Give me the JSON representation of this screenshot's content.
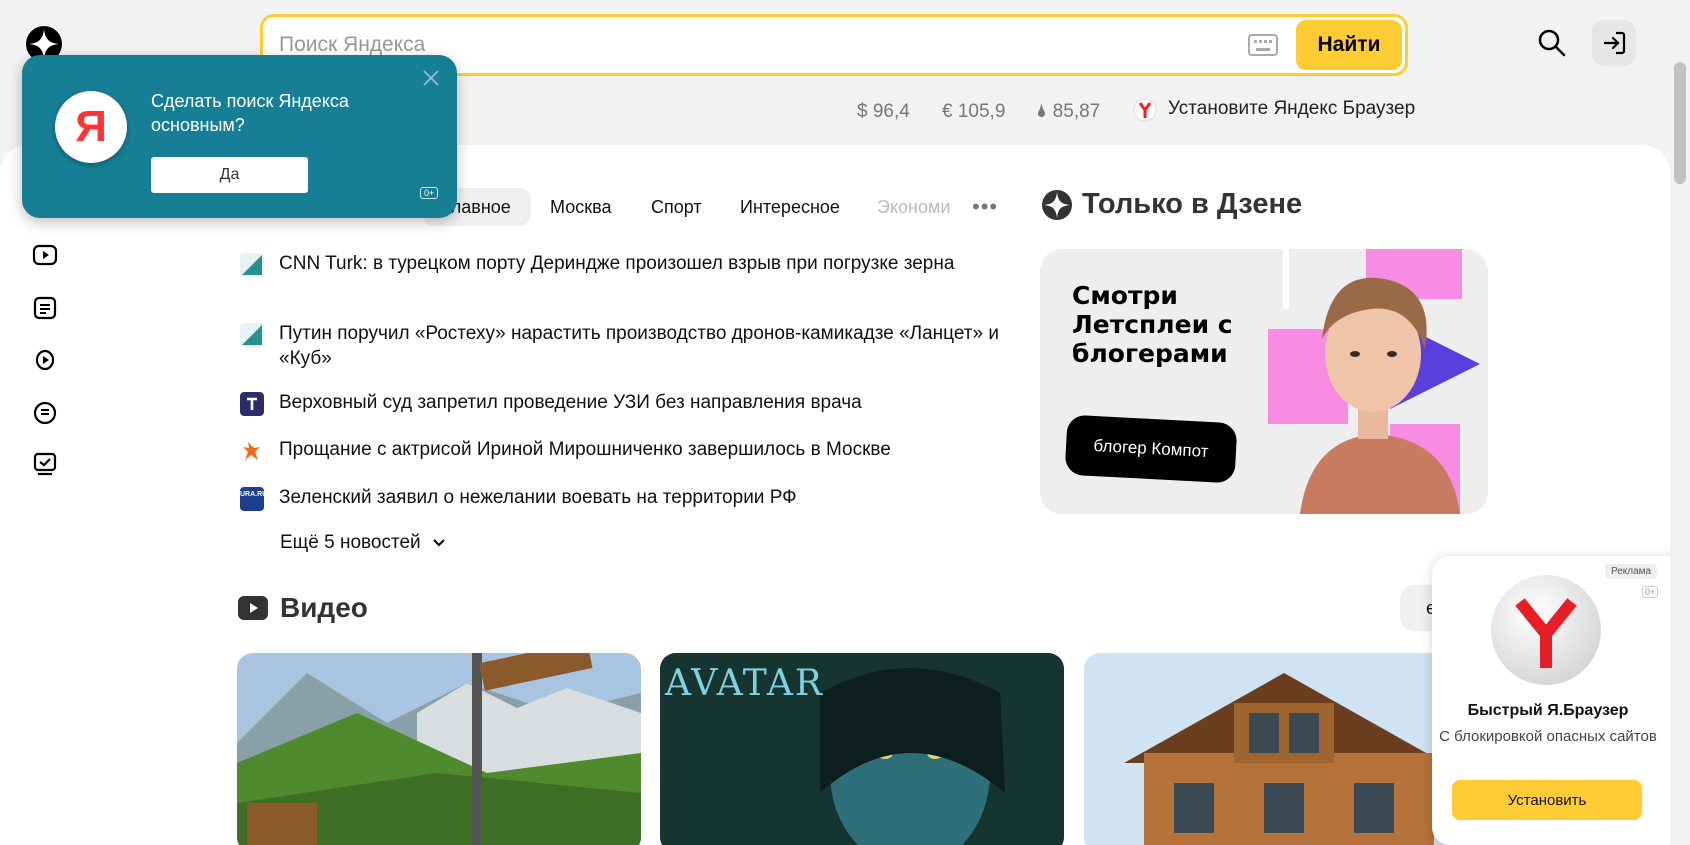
{
  "search": {
    "placeholder": "Поиск Яндекса",
    "button_label": "Найти"
  },
  "tickers": [
    {
      "label": "$ 96,4"
    },
    {
      "label": "€ 105,9"
    },
    {
      "label": "🌢 85,87"
    }
  ],
  "install_browser_link": "Установите Яндекс Браузер",
  "popup": {
    "logo_letter": "Я",
    "text": "Сделать поиск Яндекса основным?",
    "yes_label": "Да",
    "age": "0+"
  },
  "news": {
    "tabs": [
      {
        "label": "Главное"
      },
      {
        "label": "Москва"
      },
      {
        "label": "Спорт"
      },
      {
        "label": "Интересное"
      },
      {
        "label": "Экономи"
      }
    ],
    "more_tabs_icon": "more-dots-icon",
    "items": [
      {
        "source_icon": "cnn-turk-icon",
        "text": "CNN Turk: в турецком порту Дериндже произошел взрыв при погрузке зерна"
      },
      {
        "source_icon": "source-triangle-icon",
        "text": "Путин поручил «Ростеху» нарастить производство дронов-камикадзе «Ланцет» и «Куб»"
      },
      {
        "source_icon": "t-source-icon",
        "text": "Верховный суд запретил проведение УЗИ без направления врача"
      },
      {
        "source_icon": "ria-source-icon",
        "text": "Прощание с актрисой Ириной Мирошниченко завершилось в Москве"
      },
      {
        "source_icon": "ura-ru-icon",
        "source_text": "URA.RU",
        "text": "Зеленский заявил о нежелании воевать на территории РФ"
      }
    ],
    "more_label": "Ещё 5 новостей"
  },
  "video": {
    "title": "Видео",
    "more_button": "е"
  },
  "dzen": {
    "title": "Только в Дзене",
    "promo_text": "Смотри Летсплеи с блогерами",
    "blogger_label": "блогер Компот"
  },
  "ad": {
    "label": "Реклама",
    "age": "0+",
    "title": "Быстрый Я.Браузер",
    "subtitle": "С блокировкой опасных сайтов",
    "button": "Установить"
  },
  "colors": {
    "accent": "#ffcc33",
    "popup_bg": "#167f96",
    "page_bg": "#f2f2f2"
  }
}
